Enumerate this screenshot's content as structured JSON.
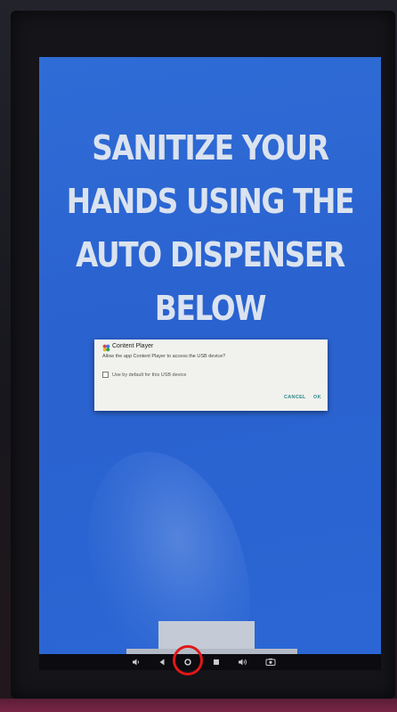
{
  "screen": {
    "headline": "SANITIZE YOUR\nHANDS USING THE\nAUTO DISPENSER\nBELOW"
  },
  "dialog": {
    "app_icon": "content-player-app-icon",
    "title": "Content Player",
    "message": "Allow the app Content Player to access the USB device?",
    "checkbox_label": "Use by default for this USB device",
    "checkbox_checked": false,
    "cancel_label": "CANCEL",
    "ok_label": "OK",
    "button_color": "#2d8a86"
  },
  "navbar": {
    "buttons": [
      {
        "name": "volume-down-icon"
      },
      {
        "name": "back-icon"
      },
      {
        "name": "home-icon",
        "highlighted": true
      },
      {
        "name": "recents-icon"
      },
      {
        "name": "volume-up-icon"
      },
      {
        "name": "screenshot-icon"
      }
    ],
    "highlight_color": "#e01818"
  },
  "colors": {
    "screen_background": "#2f6cd6",
    "headline_text": "#dbe3ef",
    "dialog_background": "#f1f1ee"
  }
}
